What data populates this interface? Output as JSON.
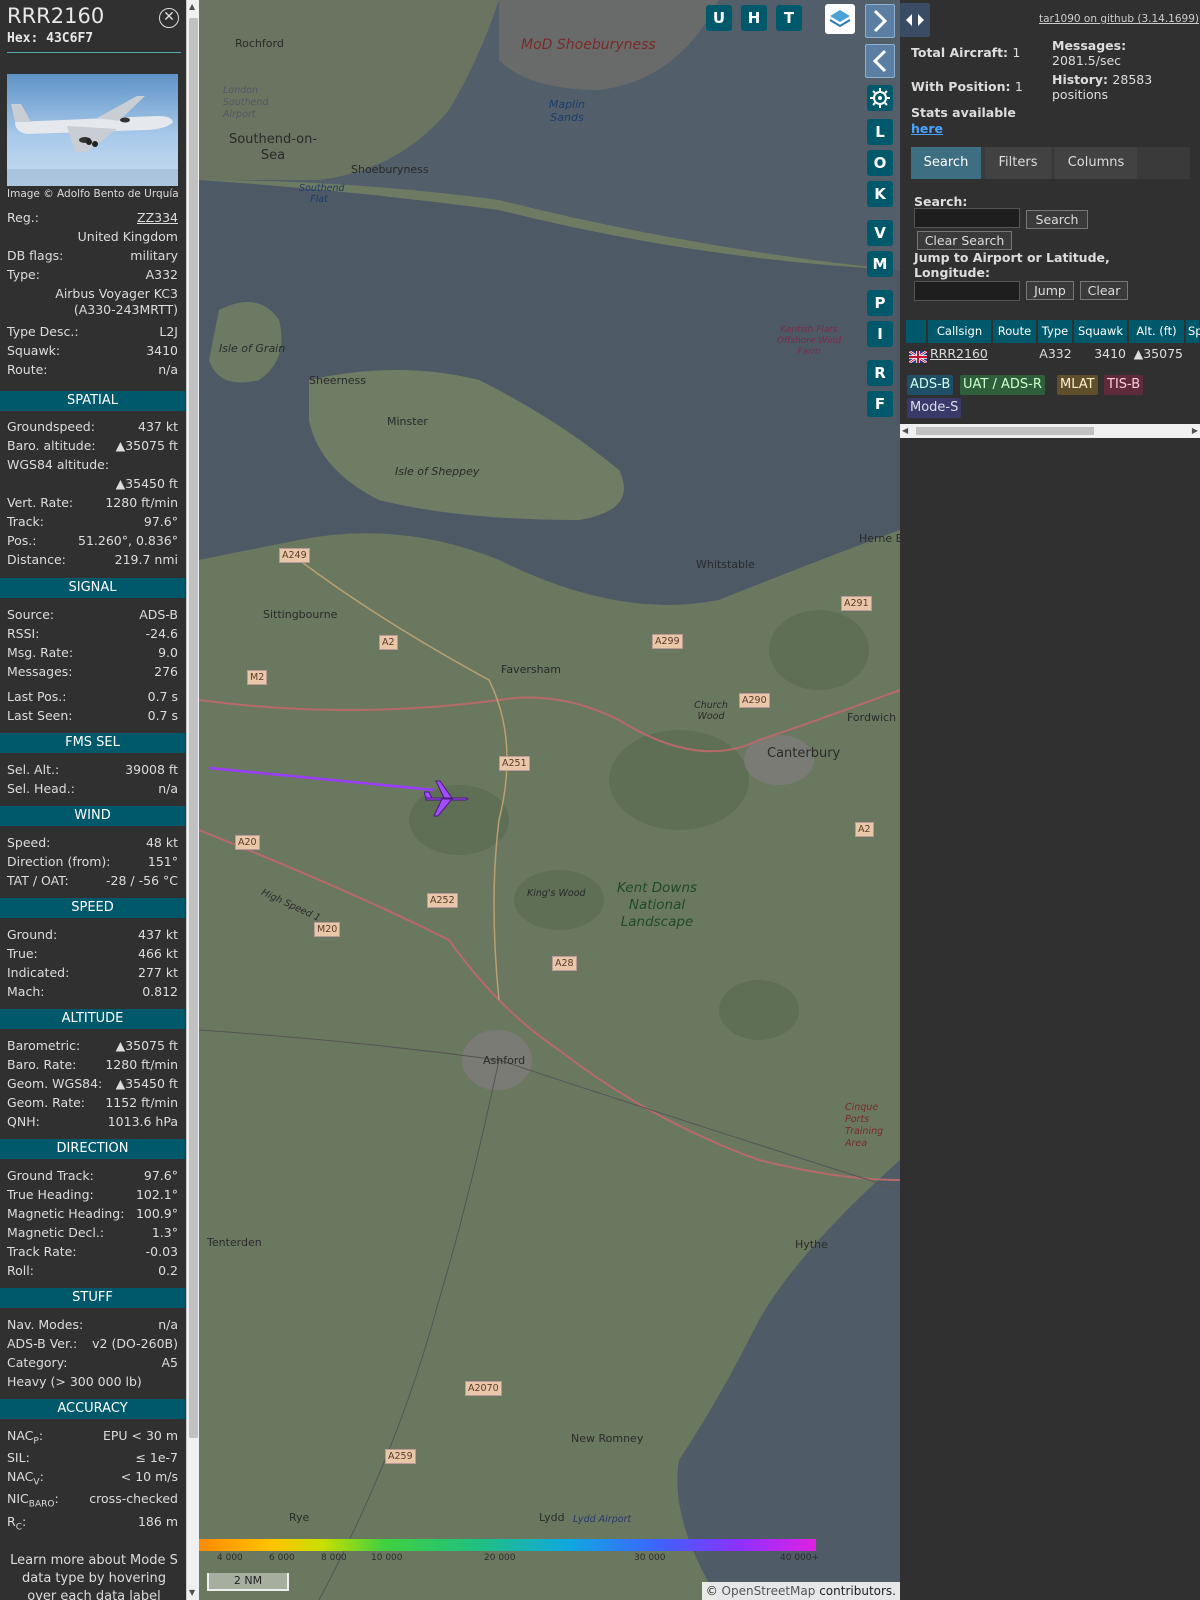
{
  "sidebar": {
    "callsign": "RRR2160",
    "hex_label": "Hex:",
    "hex": "43C6F7",
    "close_icon": "close-icon",
    "photo_credit": "Image © Adolfo Bento de Urquía",
    "reg_label": "Reg.:",
    "reg": "ZZ334",
    "country": "United Kingdom",
    "db_flags_label": "DB flags:",
    "db_flags": "military",
    "type_label": "Type:",
    "type": "A332",
    "type_name_1": "Airbus Voyager KC3",
    "type_name_2": "(A330-243MRTT)",
    "type_desc_label": "Type Desc.:",
    "type_desc": "L2J",
    "squawk_label": "Squawk:",
    "squawk": "3410",
    "route_label": "Route:",
    "route": "n/a",
    "spatial": {
      "title": "SPATIAL",
      "groundspeed_label": "Groundspeed:",
      "groundspeed": "437 kt",
      "baro_alt_label": "Baro. altitude:",
      "baro_alt": "▲35075 ft",
      "wgs84_label": "WGS84 altitude:",
      "wgs84": "▲35450 ft",
      "vert_rate_label": "Vert. Rate:",
      "vert_rate": "1280 ft/min",
      "track_label": "Track:",
      "track": "97.6°",
      "pos_label": "Pos.:",
      "pos": "51.260°, 0.836°",
      "distance_label": "Distance:",
      "distance": "219.7 nmi"
    },
    "signal": {
      "title": "SIGNAL",
      "source_label": "Source:",
      "source": "ADS-B",
      "rssi_label": "RSSI:",
      "rssi": "-24.6",
      "msg_rate_label": "Msg. Rate:",
      "msg_rate": "9.0",
      "messages_label": "Messages:",
      "messages": "276",
      "last_pos_label": "Last Pos.:",
      "last_pos": "0.7 s",
      "last_seen_label": "Last Seen:",
      "last_seen": "0.7 s"
    },
    "fms": {
      "title": "FMS SEL",
      "sel_alt_label": "Sel. Alt.:",
      "sel_alt": "39008 ft",
      "sel_head_label": "Sel. Head.:",
      "sel_head": "n/a"
    },
    "wind": {
      "title": "WIND",
      "speed_label": "Speed:",
      "speed": "48 kt",
      "dir_label": "Direction (from):",
      "dir": "151°",
      "tat_label": "TAT / OAT:",
      "tat": "-28 / -56 °C"
    },
    "speed": {
      "title": "SPEED",
      "ground_label": "Ground:",
      "ground": "437 kt",
      "true_label": "True:",
      "true": "466 kt",
      "indicated_label": "Indicated:",
      "indicated": "277 kt",
      "mach_label": "Mach:",
      "mach": "0.812"
    },
    "altitude": {
      "title": "ALTITUDE",
      "baro_label": "Barometric:",
      "baro": "▲35075 ft",
      "baro_rate_label": "Baro. Rate:",
      "baro_rate": "1280 ft/min",
      "geom_label": "Geom. WGS84:",
      "geom": "▲35450 ft",
      "geom_rate_label": "Geom. Rate:",
      "geom_rate": "1152 ft/min",
      "qnh_label": "QNH:",
      "qnh": "1013.6 hPa"
    },
    "direction": {
      "title": "DIRECTION",
      "ground_track_label": "Ground Track:",
      "ground_track": "97.6°",
      "true_heading_label": "True Heading:",
      "true_heading": "102.1°",
      "mag_heading_label": "Magnetic Heading:",
      "mag_heading": "100.9°",
      "mag_decl_label": "Magnetic Decl.:",
      "mag_decl": "1.3°",
      "track_rate_label": "Track Rate:",
      "track_rate": "-0.03",
      "roll_label": "Roll:",
      "roll": "0.2"
    },
    "stuff": {
      "title": "STUFF",
      "nav_modes_label": "Nav. Modes:",
      "nav_modes": "n/a",
      "adsb_ver_label": "ADS-B Ver.:",
      "adsb_ver": "v2 (DO-260B)",
      "category_label": "Category:",
      "category": "A5",
      "category_desc": "Heavy (> 300 000 lb)"
    },
    "accuracy": {
      "title": "ACCURACY",
      "nacp_label": "NAC",
      "nacp_sub": "P",
      "nacp": "EPU < 30 m",
      "sil_label": "SIL:",
      "sil": "≤ 1e-7",
      "nacv_label": "NAC",
      "nacv_sub": "V",
      "nacv": "< 10 m/s",
      "nicbaro_label": "NIC",
      "nicbaro_sub": "BARO",
      "nicbaro": "cross-checked",
      "rc_label": "R",
      "rc_sub": "C",
      "rc": "186 m"
    },
    "footer": "Learn more about Mode S data type by hovering over each data label"
  },
  "map": {
    "places": [
      "MoD Shoeburyness",
      "Rochford",
      "London Southend Airport",
      "Southend-on-Sea",
      "Shoeburyness",
      "Maplin Sands",
      "Southend Flat",
      "Isle of Grain",
      "Kentish Flats Offshore Wind Farm",
      "Sheerness",
      "Minster",
      "Isle of Sheppey",
      "Herne Bay",
      "Whitstable",
      "Sittingbourne",
      "Faversham",
      "Church Wood",
      "Fordwich",
      "Canterbury",
      "King's Wood",
      "Kent Downs National Landscape",
      "Ashford",
      "Cinque Ports Training Area",
      "Hythe",
      "Tenterden",
      "New Romney",
      "Rye",
      "Lydd",
      "Lydd Airport",
      "High Speed 1"
    ],
    "roads": [
      "A249",
      "A2",
      "M2",
      "A299",
      "A291",
      "A290",
      "A251",
      "A20",
      "M20",
      "A252",
      "A28",
      "A2",
      "A2070",
      "A259"
    ],
    "color_scale": [
      "4 000",
      "6 000",
      "8 000",
      "10 000",
      "20 000",
      "30 000",
      "40 000+"
    ],
    "scale_bar": "2 NM",
    "attribution_prefix": "© ",
    "attribution_link": "OpenStreetMap",
    "attribution_suffix": " contributors.",
    "buttons": [
      "U",
      "H",
      "T"
    ],
    "side_buttons": [
      "L",
      "O",
      "K",
      "V",
      "M",
      "P",
      "I",
      "R",
      "F"
    ],
    "layers_icon": "layers-icon",
    "settings_icon": "gear-icon",
    "zoom_in": "+",
    "zoom_out": "−"
  },
  "panel": {
    "github_link": "tar1090 on github (3.14.1699)",
    "total_label": "Total Aircraft:",
    "total": "1",
    "messages_label": "Messages:",
    "messages": "2081.5/sec",
    "with_pos_label": "With Position:",
    "with_pos": "1",
    "history_label": "History:",
    "history": "28583",
    "history_unit": "positions",
    "stats_label": "Stats available",
    "stats_link": "here",
    "tabs": [
      "Search",
      "Filters",
      "Columns"
    ],
    "search_label": "Search:",
    "search_button": "Search",
    "clear_search_button": "Clear Search",
    "jump_label": "Jump to Airport or Latitude, Longitude:",
    "jump_button": "Jump",
    "clear_button": "Clear",
    "table": {
      "headers": [
        "Callsign",
        "Route",
        "Type",
        "Squawk",
        "Alt. (ft)",
        "Sp"
      ],
      "rows": [
        {
          "flag": "uk-flag-icon",
          "callsign": "RRR2160",
          "route": "",
          "type": "A332",
          "squawk": "3410",
          "alt": "▲35075"
        }
      ]
    },
    "badges": [
      "ADS-B",
      "UAT / ADS-R",
      "MLAT",
      "TIS-B",
      "Mode-S"
    ],
    "colors": {
      "adsb": "#1f4f66",
      "uat": "#2f5f3a",
      "mlat": "#5f4f2a",
      "tisb": "#5f2a3a",
      "modes": "#3a3a6a"
    }
  }
}
